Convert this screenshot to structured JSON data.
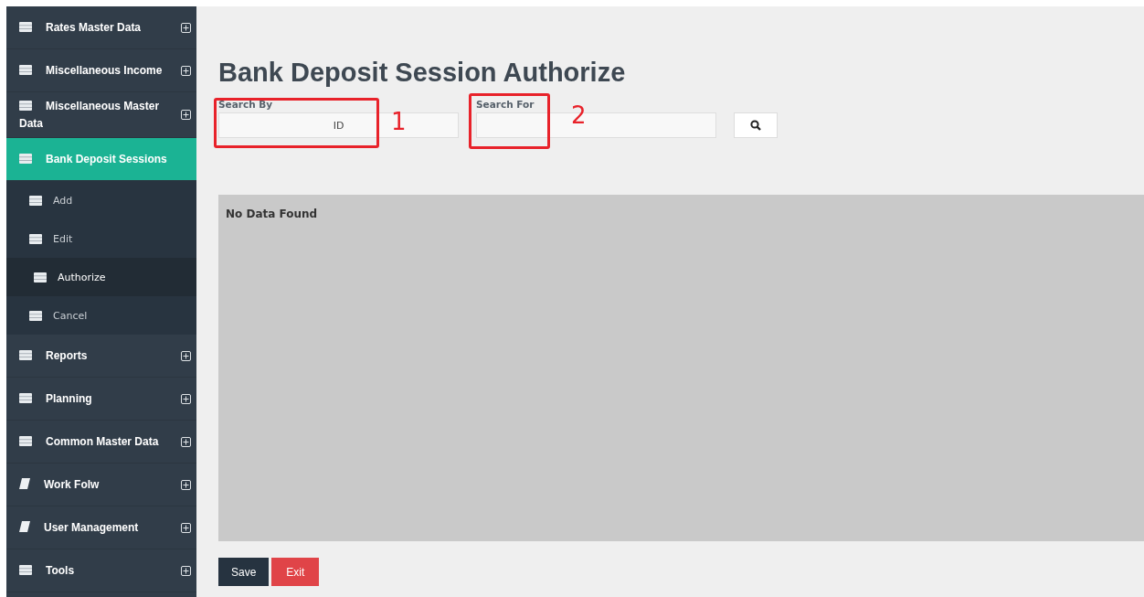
{
  "sidebar": {
    "items": [
      {
        "label": "Rates Master Data",
        "kind": "list",
        "selected": false,
        "expanded": false
      },
      {
        "label": "Miscellaneous Income",
        "kind": "list",
        "selected": false,
        "expanded": false
      },
      {
        "label": "Miscellaneous Master Data",
        "kind": "list",
        "selected": false,
        "expanded": false
      },
      {
        "label": "Bank Deposit Sessions",
        "kind": "list",
        "selected": true,
        "expanded": true,
        "children": [
          {
            "label": "Add",
            "selected": false
          },
          {
            "label": "Edit",
            "selected": false
          },
          {
            "label": "Authorize",
            "selected": true
          },
          {
            "label": "Cancel",
            "selected": false
          }
        ]
      },
      {
        "label": "Reports",
        "kind": "list",
        "selected": false,
        "expanded": false
      },
      {
        "label": "Planning",
        "kind": "list",
        "selected": false,
        "expanded": false
      },
      {
        "label": "Common Master Data",
        "kind": "list",
        "selected": false,
        "expanded": false
      },
      {
        "label": "Work Folw",
        "kind": "book",
        "selected": false,
        "expanded": false
      },
      {
        "label": "User Management",
        "kind": "book",
        "selected": false,
        "expanded": false
      },
      {
        "label": "Tools",
        "kind": "list",
        "selected": false,
        "expanded": false
      }
    ]
  },
  "page": {
    "title": "Bank Deposit Session Authorize"
  },
  "search": {
    "search_by": {
      "label": "Search By",
      "value": "ID"
    },
    "search_for": {
      "label": "Search For"
    }
  },
  "results": {
    "message": "No Data Found"
  },
  "buttons": [
    {
      "label": "Save",
      "kind": "primary"
    },
    {
      "label": "Exit",
      "kind": "danger"
    }
  ],
  "annotations": [
    {
      "label": "1"
    },
    {
      "label": "2"
    }
  ]
}
